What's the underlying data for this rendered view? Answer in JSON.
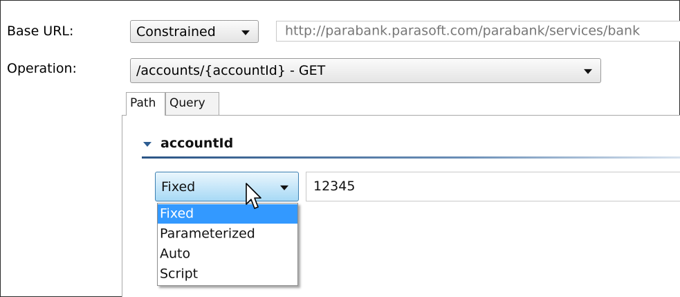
{
  "form": {
    "base_url_label": "Base URL:",
    "base_url_mode": "Constrained",
    "base_url_value": "http://parabank.parasoft.com/parabank/services/bank",
    "operation_label": "Operation:",
    "operation_value": "/accounts/{accountId} - GET"
  },
  "tabs": [
    {
      "label": "Path",
      "active": true
    },
    {
      "label": "Query",
      "active": false
    }
  ],
  "section": {
    "title": "accountId"
  },
  "parameter": {
    "mode_value": "Fixed",
    "value": "12345"
  },
  "dropdown": {
    "options": [
      "Fixed",
      "Parameterized",
      "Auto",
      "Script"
    ],
    "selected_index": 0
  },
  "icons": {
    "combo_arrow": "chevron-down-icon",
    "section_toggle": "triangle-down-icon",
    "pointer": "mouse-pointer-icon"
  },
  "colors": {
    "selection": "#3399ff",
    "section_rule": "#2b5586",
    "hovered_combo": "#a7d9f5"
  }
}
